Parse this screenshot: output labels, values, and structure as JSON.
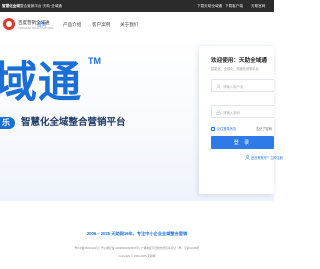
{
  "topbar": {
    "brand": "智慧化全域",
    "left_rest": "整合营销平台·天助·全域通",
    "links": [
      "下载天助全域通",
      "下载客户端",
      "天助官网"
    ]
  },
  "header": {
    "logo_text": "百度营销全域通",
    "logo_sub": "TIANZHU QUANYUTONG",
    "nav": [
      "首页",
      "产品介绍",
      "客户案例",
      "关于我们"
    ]
  },
  "hero": {
    "title": "域通",
    "tm": "TM",
    "badge": "乐",
    "subtitle": "智慧化全域整合营销平台"
  },
  "login": {
    "title": "欢迎使用：天助全域通",
    "description": "智能化、全域化、精细化营销平台",
    "username_placeholder": "请输入用户名",
    "password_placeholder": "请输入密码",
    "remember_label": "记住登录状态",
    "forgot_label": "忘记了密码",
    "submit_label": "登 录",
    "register_label": "还没有账号？立即注册"
  },
  "footer": {
    "slogan": "2006 – 2025   天助网19年，专注中小企业全域整合营销",
    "links": "粤ICP备05011322号  |  粤公网安备 44030502004537号  |  广播电视节目制作经营许可证（粤）字第01009号",
    "copyright": "Copyright © 2006-2025 天助网"
  },
  "colors": {
    "brand_blue": "#1a6fd6",
    "button_blue": "#2e7be8",
    "topbar_bg": "#2b2b2b",
    "logo_red": "#e0392b"
  }
}
